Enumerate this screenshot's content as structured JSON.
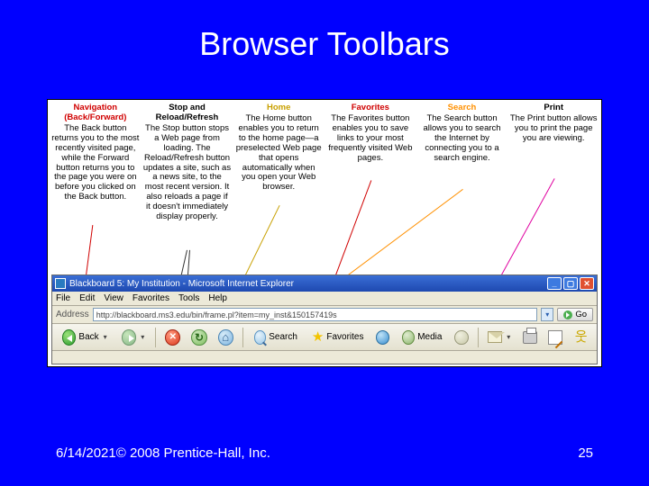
{
  "title": "Browser Toolbars",
  "annotations": {
    "nav": {
      "heading": "Navigation (Back/Forward)",
      "body": "The Back button returns you to the most recently visited page, while the Forward button returns you to the page you were on before you clicked on the Back button."
    },
    "stop": {
      "heading": "Stop and Reload/Refresh",
      "body": "The Stop button stops a Web page from loading. The Reload/Refresh button updates a site, such as a news site, to the most recent version. It also reloads a page if it doesn't immediately display properly."
    },
    "home": {
      "heading": "Home",
      "body": "The Home button enables you to return to the home page—a preselected Web page that opens automatically when you open your Web browser."
    },
    "fav": {
      "heading": "Favorites",
      "body": "The Favorites button enables you to save links to your most frequently visited Web pages."
    },
    "search": {
      "heading": "Search",
      "body": "The Search button allows you to search the Internet by connecting you to a search engine."
    },
    "print": {
      "heading": "Print",
      "body": "The Print button allows you to print the page you are viewing."
    }
  },
  "ie": {
    "window_title": "Blackboard 5: My Institution - Microsoft Internet Explorer",
    "menu": [
      "File",
      "Edit",
      "View",
      "Favorites",
      "Tools",
      "Help"
    ],
    "address_label": "Address",
    "address_value": "http://blackboard.ms3.edu/bin/frame.pl?item=my_inst&150157419s",
    "go_label": "Go",
    "back_label": "Back",
    "search_label": "Search",
    "favorites_label": "Favorites",
    "media_label": "Media"
  },
  "footer": {
    "left": "6/14/2021© 2008 Prentice-Hall, Inc.",
    "page": "25"
  }
}
